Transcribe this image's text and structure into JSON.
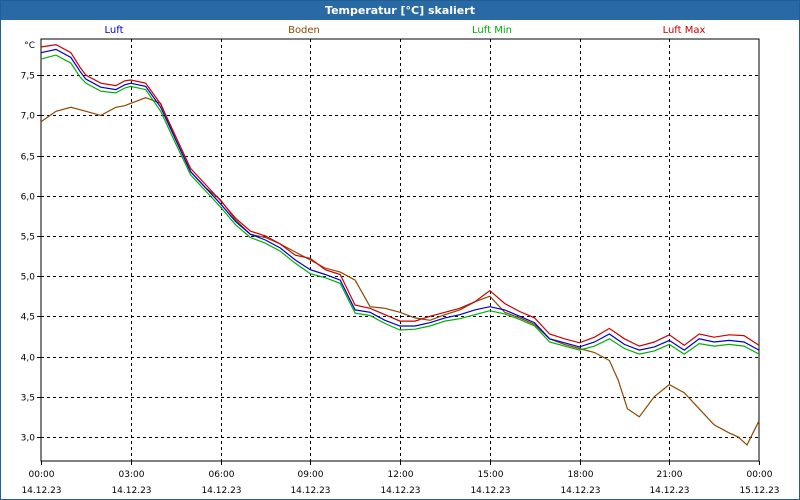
{
  "window": {
    "title": "Temperatur [°C] skaliert"
  },
  "chart_data": {
    "type": "line",
    "title": "Temperatur [°C] skaliert",
    "ylabel": "°C",
    "xlabel": "",
    "ylim": [
      2.7,
      7.95
    ],
    "yticks": [
      3.0,
      3.5,
      4.0,
      4.5,
      5.0,
      5.5,
      6.0,
      6.5,
      7.0,
      7.5
    ],
    "yticks_labels": [
      "3,0",
      "3,5",
      "4,0",
      "4,5",
      "5,0",
      "5,5",
      "6,0",
      "6,5",
      "7,0",
      "7,5"
    ],
    "xlim": [
      0,
      24
    ],
    "xticks": [
      0,
      3,
      6,
      9,
      12,
      15,
      18,
      21,
      24
    ],
    "xtick_labels": [
      {
        "time": "00:00",
        "date": "14.12.23"
      },
      {
        "time": "03:00",
        "date": "14.12.23"
      },
      {
        "time": "06:00",
        "date": "14.12.23"
      },
      {
        "time": "09:00",
        "date": "14.12.23"
      },
      {
        "time": "12:00",
        "date": "14.12.23"
      },
      {
        "time": "15:00",
        "date": "14.12.23"
      },
      {
        "time": "18:00",
        "date": "14.12.23"
      },
      {
        "time": "21:00",
        "date": "14.12.23"
      },
      {
        "time": "00:00",
        "date": "15.12.23"
      }
    ],
    "grid": true,
    "legend_position": "top",
    "series": [
      {
        "name": "Luft",
        "color": "#0000cc",
        "x": [
          0,
          0.5,
          1.0,
          1.3,
          1.5,
          2.0,
          2.5,
          2.8,
          3.0,
          3.5,
          4.0,
          4.5,
          5.0,
          5.5,
          6.0,
          6.5,
          7.0,
          7.5,
          8.0,
          8.5,
          9.0,
          9.5,
          10.0,
          10.5,
          11.0,
          11.5,
          12.0,
          12.5,
          13.0,
          13.5,
          14.0,
          14.5,
          15.0,
          15.5,
          16.0,
          16.5,
          17.0,
          17.5,
          18.0,
          18.5,
          19.0,
          19.5,
          20.0,
          20.5,
          21.0,
          21.5,
          22.0,
          22.5,
          23.0,
          23.5,
          24.0
        ],
        "values": [
          7.78,
          7.82,
          7.72,
          7.55,
          7.45,
          7.35,
          7.32,
          7.38,
          7.4,
          7.36,
          7.1,
          6.7,
          6.3,
          6.1,
          5.9,
          5.68,
          5.52,
          5.45,
          5.35,
          5.2,
          5.08,
          5.02,
          4.95,
          4.58,
          4.55,
          4.45,
          4.38,
          4.38,
          4.42,
          4.48,
          4.52,
          4.58,
          4.62,
          4.58,
          4.5,
          4.42,
          4.22,
          4.17,
          4.12,
          4.18,
          4.28,
          4.15,
          4.08,
          4.12,
          4.2,
          4.08,
          4.22,
          4.18,
          4.2,
          4.18,
          4.08
        ]
      },
      {
        "name": "Boden",
        "color": "#8b4a00",
        "x": [
          0,
          0.5,
          1.0,
          1.5,
          2.0,
          2.5,
          2.8,
          3.0,
          3.5,
          4.0,
          4.5,
          5.0,
          5.5,
          6.0,
          6.5,
          7.0,
          7.5,
          8.0,
          8.5,
          9.0,
          9.5,
          10.0,
          10.5,
          11.0,
          11.5,
          12.0,
          12.5,
          13.0,
          13.5,
          14.0,
          14.5,
          15.0,
          15.5,
          16.0,
          16.5,
          17.0,
          17.5,
          18.0,
          18.5,
          19.0,
          19.3,
          19.6,
          20.0,
          20.5,
          21.0,
          21.5,
          22.0,
          22.5,
          23.0,
          23.3,
          23.6,
          24.0
        ],
        "values": [
          6.92,
          7.05,
          7.1,
          7.05,
          7.0,
          7.1,
          7.12,
          7.15,
          7.22,
          7.15,
          6.7,
          6.3,
          6.1,
          5.95,
          5.7,
          5.52,
          5.48,
          5.4,
          5.3,
          5.2,
          5.1,
          5.05,
          4.95,
          4.62,
          4.6,
          4.55,
          4.48,
          4.45,
          4.52,
          4.58,
          4.68,
          4.75,
          4.55,
          4.48,
          4.4,
          4.22,
          4.15,
          4.1,
          4.05,
          3.95,
          3.7,
          3.35,
          3.25,
          3.5,
          3.65,
          3.55,
          3.35,
          3.15,
          3.05,
          3.0,
          2.9,
          3.2
        ]
      },
      {
        "name": "Luft Min",
        "color": "#00b000",
        "x": [
          0,
          0.5,
          1.0,
          1.3,
          1.5,
          2.0,
          2.5,
          2.8,
          3.0,
          3.5,
          4.0,
          4.5,
          5.0,
          5.5,
          6.0,
          6.5,
          7.0,
          7.5,
          8.0,
          8.5,
          9.0,
          9.5,
          10.0,
          10.5,
          11.0,
          11.5,
          12.0,
          12.5,
          13.0,
          13.5,
          14.0,
          14.5,
          15.0,
          15.5,
          16.0,
          16.5,
          17.0,
          17.5,
          18.0,
          18.5,
          19.0,
          19.5,
          20.0,
          20.5,
          21.0,
          21.5,
          22.0,
          22.5,
          23.0,
          23.5,
          24.0
        ],
        "values": [
          7.7,
          7.75,
          7.65,
          7.48,
          7.4,
          7.3,
          7.28,
          7.34,
          7.36,
          7.32,
          7.05,
          6.65,
          6.26,
          6.06,
          5.86,
          5.64,
          5.48,
          5.41,
          5.31,
          5.16,
          5.03,
          4.98,
          4.91,
          4.54,
          4.51,
          4.41,
          4.33,
          4.34,
          4.38,
          4.44,
          4.47,
          4.52,
          4.57,
          4.53,
          4.46,
          4.38,
          4.18,
          4.13,
          4.08,
          4.13,
          4.22,
          4.1,
          4.03,
          4.07,
          4.15,
          4.03,
          4.16,
          4.13,
          4.15,
          4.13,
          4.03
        ]
      },
      {
        "name": "Luft Max",
        "color": "#cc0000",
        "x": [
          0,
          0.5,
          1.0,
          1.3,
          1.5,
          2.0,
          2.5,
          2.8,
          3.0,
          3.5,
          4.0,
          4.5,
          5.0,
          5.5,
          6.0,
          6.5,
          7.0,
          7.5,
          8.0,
          8.5,
          9.0,
          9.5,
          10.0,
          10.5,
          11.0,
          11.5,
          12.0,
          12.5,
          13.0,
          13.5,
          14.0,
          14.5,
          15.0,
          15.5,
          16.0,
          16.5,
          17.0,
          17.5,
          18.0,
          18.5,
          19.0,
          19.5,
          20.0,
          20.5,
          21.0,
          21.5,
          22.0,
          22.5,
          23.0,
          23.5,
          24.0
        ],
        "values": [
          7.85,
          7.88,
          7.78,
          7.6,
          7.5,
          7.4,
          7.37,
          7.43,
          7.44,
          7.4,
          7.14,
          6.74,
          6.34,
          6.14,
          5.94,
          5.72,
          5.56,
          5.5,
          5.4,
          5.26,
          5.22,
          5.08,
          5.02,
          4.64,
          4.6,
          4.52,
          4.44,
          4.44,
          4.5,
          4.55,
          4.6,
          4.68,
          4.82,
          4.66,
          4.56,
          4.48,
          4.28,
          4.22,
          4.17,
          4.24,
          4.35,
          4.22,
          4.13,
          4.18,
          4.27,
          4.14,
          4.28,
          4.24,
          4.27,
          4.26,
          4.14
        ]
      }
    ]
  }
}
